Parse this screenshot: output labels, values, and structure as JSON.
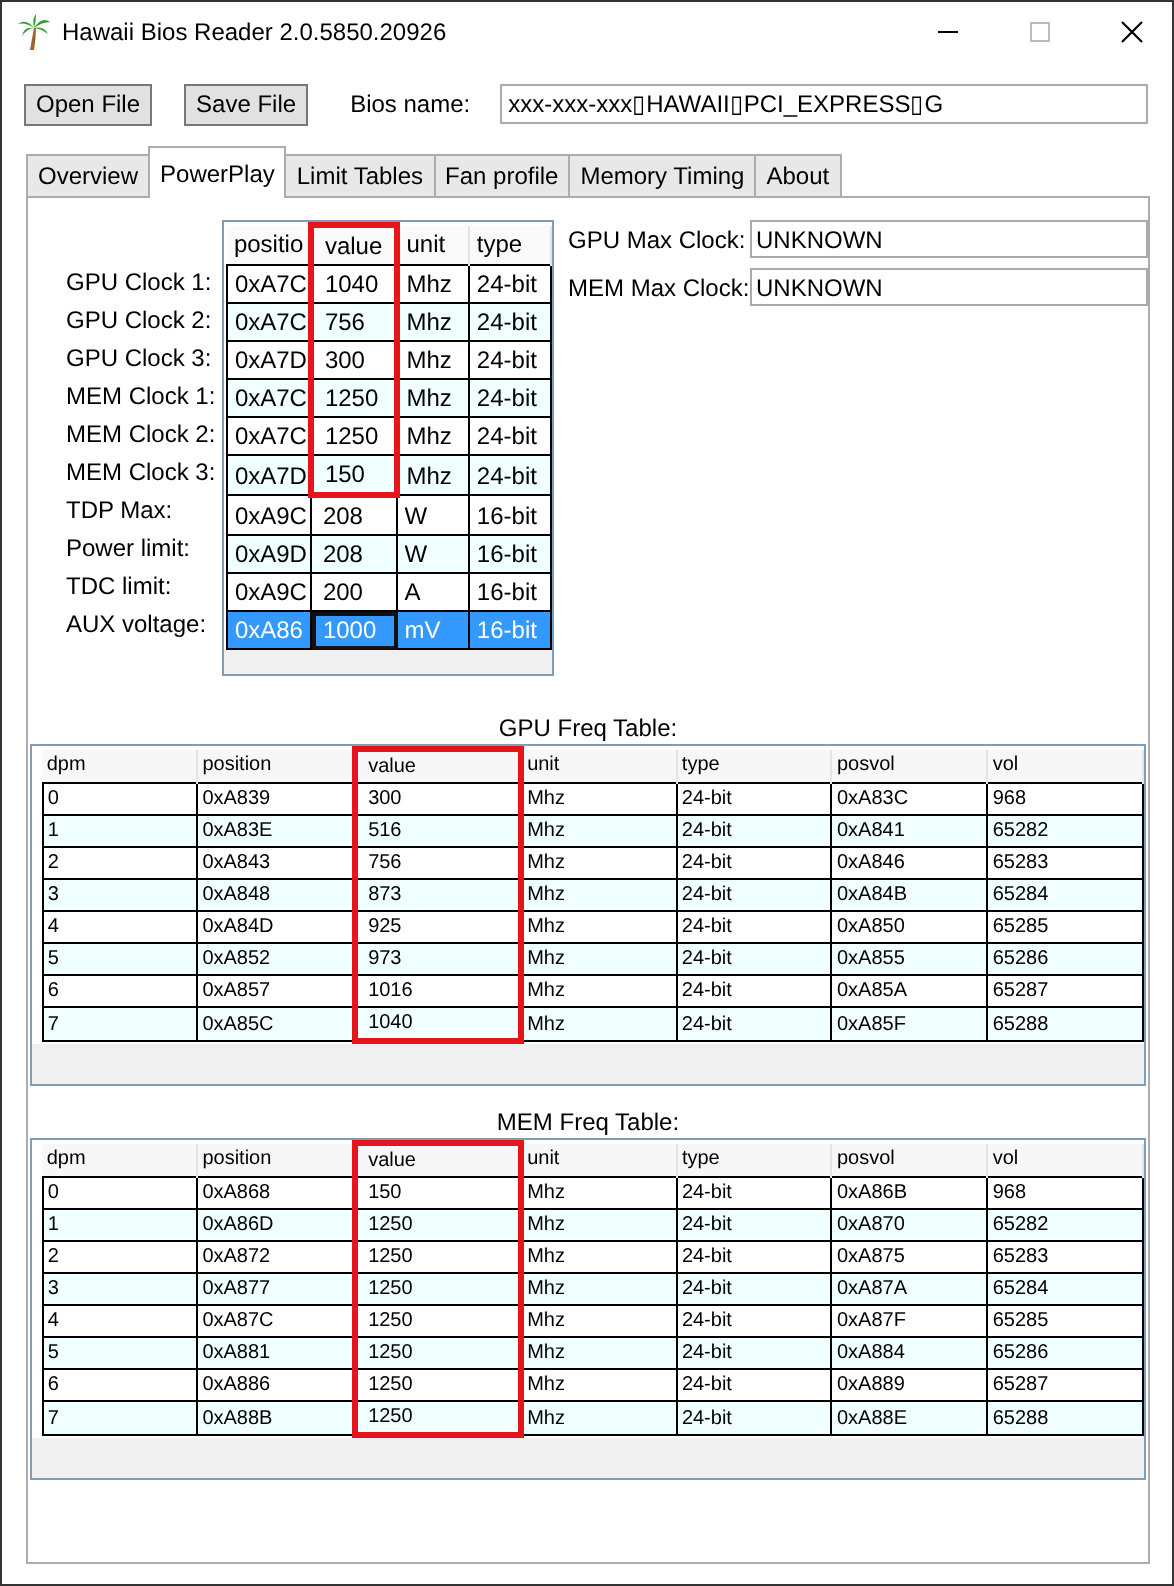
{
  "window": {
    "title": "Hawaii Bios Reader 2.0.5850.20926"
  },
  "toolbar": {
    "buttons": [
      "Open File",
      "Save File"
    ],
    "bios_label": "Bios name:",
    "bios_value": "xxx-xxx-xxx▯HAWAII▯PCI_EXPRESS▯G"
  },
  "tabs": [
    {
      "label": "Overview",
      "selected": false
    },
    {
      "label": "PowerPlay",
      "selected": true
    },
    {
      "label": "Limit Tables",
      "selected": false
    },
    {
      "label": "Fan profile",
      "selected": false
    },
    {
      "label": "Memory Timing",
      "selected": false
    },
    {
      "label": "About",
      "selected": false
    }
  ],
  "powerplay": {
    "labels": [
      "GPU Clock 1:",
      "GPU Clock 2:",
      "GPU Clock 3:",
      "MEM Clock 1:",
      "MEM Clock 2:",
      "MEM Clock 3:",
      "TDP Max:",
      "Power limit:",
      "TDC limit:",
      "AUX voltage:"
    ],
    "columns": [
      {
        "label": "positio",
        "highlighted": false
      },
      {
        "label": "value",
        "highlighted": true
      },
      {
        "label": "unit",
        "highlighted": false
      },
      {
        "label": "type",
        "highlighted": false
      }
    ],
    "rows": [
      {
        "cells": [
          "0xA7C",
          "1040",
          "Mhz",
          "24-bit"
        ],
        "selected": false,
        "highlighted": true
      },
      {
        "cells": [
          "0xA7C",
          "756",
          "Mhz",
          "24-bit"
        ],
        "selected": false,
        "highlighted": true
      },
      {
        "cells": [
          "0xA7D",
          "300",
          "Mhz",
          "24-bit"
        ],
        "selected": false,
        "highlighted": true
      },
      {
        "cells": [
          "0xA7C",
          "1250",
          "Mhz",
          "24-bit"
        ],
        "selected": false,
        "highlighted": true
      },
      {
        "cells": [
          "0xA7C",
          "1250",
          "Mhz",
          "24-bit"
        ],
        "selected": false,
        "highlighted": true
      },
      {
        "cells": [
          "0xA7D",
          "150",
          "Mhz",
          "24-bit"
        ],
        "selected": false,
        "highlighted": true
      },
      {
        "cells": [
          "0xA9C",
          "208",
          "W",
          "16-bit"
        ],
        "selected": false,
        "highlighted": false
      },
      {
        "cells": [
          "0xA9D",
          "208",
          "W",
          "16-bit"
        ],
        "selected": false,
        "highlighted": false
      },
      {
        "cells": [
          "0xA9C",
          "200",
          "A",
          "16-bit"
        ],
        "selected": false,
        "highlighted": false
      },
      {
        "cells": [
          "0xA86",
          "1000",
          "mV",
          "16-bit"
        ],
        "selected": true,
        "highlighted": false
      }
    ],
    "fields": [
      {
        "label": "GPU Max Clock:",
        "value": "UNKNOWN"
      },
      {
        "label": "MEM Max Clock:",
        "value": "UNKNOWN"
      }
    ]
  },
  "gpu_freq_table": {
    "title": "GPU Freq Table:",
    "columns": [
      {
        "label": "dpm",
        "highlighted": false
      },
      {
        "label": "position",
        "highlighted": false
      },
      {
        "label": "value",
        "highlighted": true
      },
      {
        "label": "unit",
        "highlighted": false
      },
      {
        "label": "type",
        "highlighted": false
      },
      {
        "label": "posvol",
        "highlighted": false
      },
      {
        "label": "vol",
        "highlighted": false
      }
    ],
    "rows": [
      [
        "0",
        "0xA839",
        "300",
        "Mhz",
        "24-bit",
        "0xA83C",
        "968"
      ],
      [
        "1",
        "0xA83E",
        "516",
        "Mhz",
        "24-bit",
        "0xA841",
        "65282"
      ],
      [
        "2",
        "0xA843",
        "756",
        "Mhz",
        "24-bit",
        "0xA846",
        "65283"
      ],
      [
        "3",
        "0xA848",
        "873",
        "Mhz",
        "24-bit",
        "0xA84B",
        "65284"
      ],
      [
        "4",
        "0xA84D",
        "925",
        "Mhz",
        "24-bit",
        "0xA850",
        "65285"
      ],
      [
        "5",
        "0xA852",
        "973",
        "Mhz",
        "24-bit",
        "0xA855",
        "65286"
      ],
      [
        "6",
        "0xA857",
        "1016",
        "Mhz",
        "24-bit",
        "0xA85A",
        "65287"
      ],
      [
        "7",
        "0xA85C",
        "1040",
        "Mhz",
        "24-bit",
        "0xA85F",
        "65288"
      ]
    ]
  },
  "mem_freq_table": {
    "title": "MEM Freq Table:",
    "columns": [
      {
        "label": "dpm",
        "highlighted": false
      },
      {
        "label": "position",
        "highlighted": false
      },
      {
        "label": "value",
        "highlighted": true
      },
      {
        "label": "unit",
        "highlighted": false
      },
      {
        "label": "type",
        "highlighted": false
      },
      {
        "label": "posvol",
        "highlighted": false
      },
      {
        "label": "vol",
        "highlighted": false
      }
    ],
    "rows": [
      [
        "0",
        "0xA868",
        "150",
        "Mhz",
        "24-bit",
        "0xA86B",
        "968"
      ],
      [
        "1",
        "0xA86D",
        "1250",
        "Mhz",
        "24-bit",
        "0xA870",
        "65282"
      ],
      [
        "2",
        "0xA872",
        "1250",
        "Mhz",
        "24-bit",
        "0xA875",
        "65283"
      ],
      [
        "3",
        "0xA877",
        "1250",
        "Mhz",
        "24-bit",
        "0xA87A",
        "65284"
      ],
      [
        "4",
        "0xA87C",
        "1250",
        "Mhz",
        "24-bit",
        "0xA87F",
        "65285"
      ],
      [
        "5",
        "0xA881",
        "1250",
        "Mhz",
        "24-bit",
        "0xA884",
        "65286"
      ],
      [
        "6",
        "0xA886",
        "1250",
        "Mhz",
        "24-bit",
        "0xA889",
        "65287"
      ],
      [
        "7",
        "0xA88B",
        "1250",
        "Mhz",
        "24-bit",
        "0xA88E",
        "65288"
      ]
    ]
  }
}
